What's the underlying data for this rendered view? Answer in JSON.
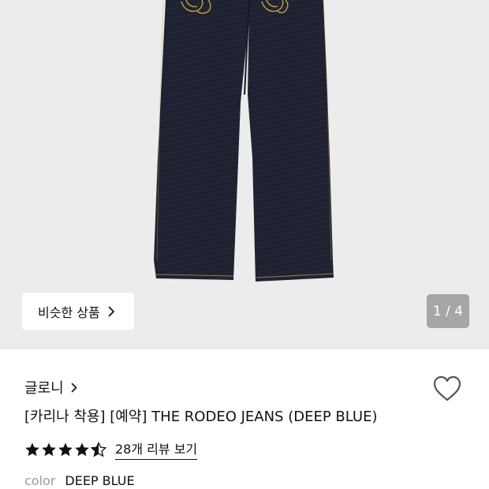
{
  "gallery": {
    "similar_button_label": "비슷한 상품",
    "counter": "1 / 4",
    "background_color": "#ececec",
    "denim_color": "#1e2230",
    "stitch_color": "#c9a24a"
  },
  "product": {
    "brand": "글로니",
    "title": "[카리나 착용] [예약] THE RODEO JEANS (DEEP BLUE)",
    "rating": 4.5,
    "review_link": "28개 리뷰 보기",
    "color_label": "color",
    "color_value": "DEEP BLUE"
  },
  "icons": {
    "similar_chevron": "chevron-right-icon",
    "brand_chevron": "chevron-right-icon",
    "wishlist": "heart-outline-icon",
    "rating": "star-icon"
  }
}
